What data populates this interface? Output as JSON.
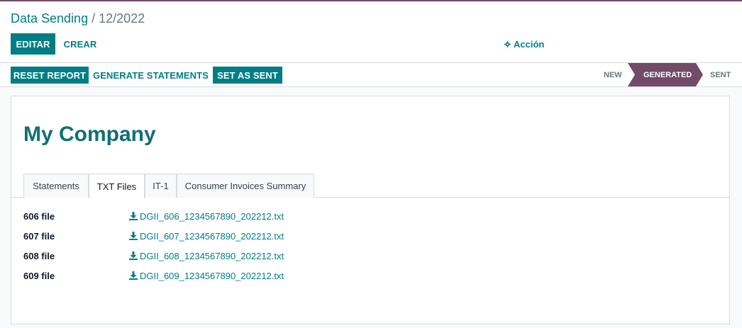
{
  "breadcrumb": {
    "parent": "Data Sending",
    "separator": "/",
    "current": "12/2022"
  },
  "toolbar": {
    "edit_label": "EDITAR",
    "create_label": "CREAR",
    "action_label": "Acción",
    "action_icon": "gear-icon"
  },
  "statusbar": {
    "buttons": {
      "reset": "RESET REPORT",
      "generate": "GENERATE STATEMENTS",
      "sent": "SET AS SENT"
    },
    "stages": [
      {
        "label": "NEW",
        "active": false
      },
      {
        "label": "GENERATED",
        "active": true
      },
      {
        "label": "SENT",
        "active": false
      }
    ]
  },
  "record": {
    "company": "My Company"
  },
  "tabs": [
    {
      "label": "Statements",
      "active": false
    },
    {
      "label": "TXT Files",
      "active": true
    },
    {
      "label": "IT-1",
      "active": false
    },
    {
      "label": "Consumer Invoices Summary",
      "active": false
    }
  ],
  "files": [
    {
      "label": "606 file",
      "filename": "DGII_606_1234567890_202212.txt",
      "icon": "download-icon"
    },
    {
      "label": "607 file",
      "filename": "DGII_607_1234567890_202212.txt",
      "icon": "download-icon"
    },
    {
      "label": "608 file",
      "filename": "DGII_608_1234567890_202212.txt",
      "icon": "download-icon"
    },
    {
      "label": "609 file",
      "filename": "DGII_609_1234567890_202212.txt",
      "icon": "download-icon"
    }
  ],
  "colors": {
    "brand": "#714b67",
    "accent": "#017e84",
    "title": "#126f74"
  }
}
